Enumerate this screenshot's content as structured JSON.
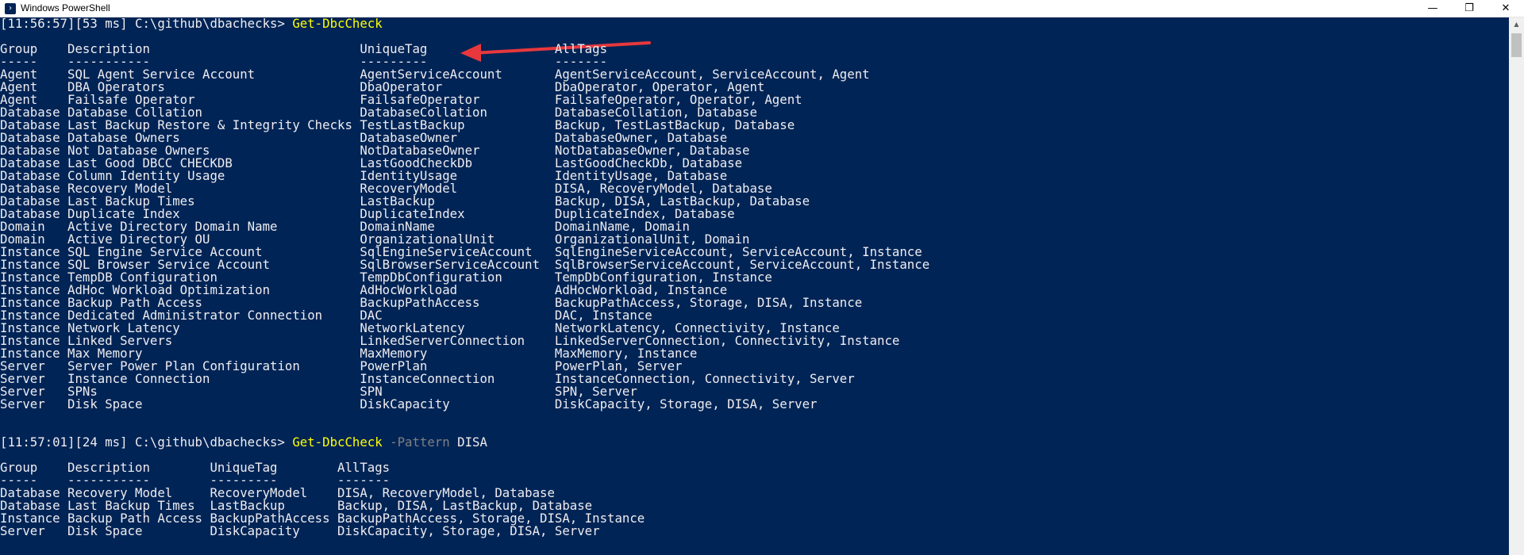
{
  "window": {
    "title": "Windows PowerShell",
    "minimize_glyph": "—",
    "restore_glyph": "❐",
    "close_glyph": "✕"
  },
  "colors": {
    "console_bg": "#012456",
    "console_fg": "#eeedf0",
    "command": "#ffff00",
    "parameter": "#808080",
    "arrow": "#e8383d"
  },
  "icons": {
    "app": "powershell-icon",
    "arrow": "red-arrow-annotation"
  },
  "session1": {
    "prompt": "[11:56:57][53 ms] C:\\github\\dbachecks> ",
    "command": "Get-DbcCheck",
    "header": "Group    Description                            UniqueTag                 AllTags",
    "separator": "-----    -----------                            ---------                 -------",
    "rows": [
      "Agent    SQL Agent Service Account              AgentServiceAccount       AgentServiceAccount, ServiceAccount, Agent",
      "Agent    DBA Operators                          DbaOperator               DbaOperator, Operator, Agent",
      "Agent    Failsafe Operator                      FailsafeOperator          FailsafeOperator, Operator, Agent",
      "Database Database Collation                     DatabaseCollation         DatabaseCollation, Database",
      "Database Last Backup Restore & Integrity Checks TestLastBackup            Backup, TestLastBackup, Database",
      "Database Database Owners                        DatabaseOwner             DatabaseOwner, Database",
      "Database Not Database Owners                    NotDatabaseOwner          NotDatabaseOwner, Database",
      "Database Last Good DBCC CHECKDB                 LastGoodCheckDb           LastGoodCheckDb, Database",
      "Database Column Identity Usage                  IdentityUsage             IdentityUsage, Database",
      "Database Recovery Model                         RecoveryModel             DISA, RecoveryModel, Database",
      "Database Last Backup Times                      LastBackup                Backup, DISA, LastBackup, Database",
      "Database Duplicate Index                        DuplicateIndex            DuplicateIndex, Database",
      "Domain   Active Directory Domain Name           DomainName                DomainName, Domain",
      "Domain   Active Directory OU                    OrganizationalUnit        OrganizationalUnit, Domain",
      "Instance SQL Engine Service Account             SqlEngineServiceAccount   SqlEngineServiceAccount, ServiceAccount, Instance",
      "Instance SQL Browser Service Account            SqlBrowserServiceAccount  SqlBrowserServiceAccount, ServiceAccount, Instance",
      "Instance TempDB Configuration                   TempDbConfiguration       TempDbConfiguration, Instance",
      "Instance AdHoc Workload Optimization            AdHocWorkload             AdHocWorkload, Instance",
      "Instance Backup Path Access                     BackupPathAccess          BackupPathAccess, Storage, DISA, Instance",
      "Instance Dedicated Administrator Connection     DAC                       DAC, Instance",
      "Instance Network Latency                        NetworkLatency            NetworkLatency, Connectivity, Instance",
      "Instance Linked Servers                         LinkedServerConnection    LinkedServerConnection, Connectivity, Instance",
      "Instance Max Memory                             MaxMemory                 MaxMemory, Instance",
      "Server   Server Power Plan Configuration        PowerPlan                 PowerPlan, Server",
      "Server   Instance Connection                    InstanceConnection        InstanceConnection, Connectivity, Server",
      "Server   SPNs                                   SPN                       SPN, Server",
      "Server   Disk Space                             DiskCapacity              DiskCapacity, Storage, DISA, Server"
    ]
  },
  "session2": {
    "prompt": "[11:57:01][24 ms] C:\\github\\dbachecks> ",
    "command": "Get-DbcCheck",
    "parameter": " -Pattern",
    "argument": " DISA",
    "header": "Group    Description        UniqueTag        AllTags",
    "separator": "-----    -----------        ---------        -------",
    "rows": [
      "Database Recovery Model     RecoveryModel    DISA, RecoveryModel, Database",
      "Database Last Backup Times  LastBackup       Backup, DISA, LastBackup, Database",
      "Instance Backup Path Access BackupPathAccess BackupPathAccess, Storage, DISA, Instance",
      "Server   Disk Space         DiskCapacity     DiskCapacity, Storage, DISA, Server"
    ]
  }
}
